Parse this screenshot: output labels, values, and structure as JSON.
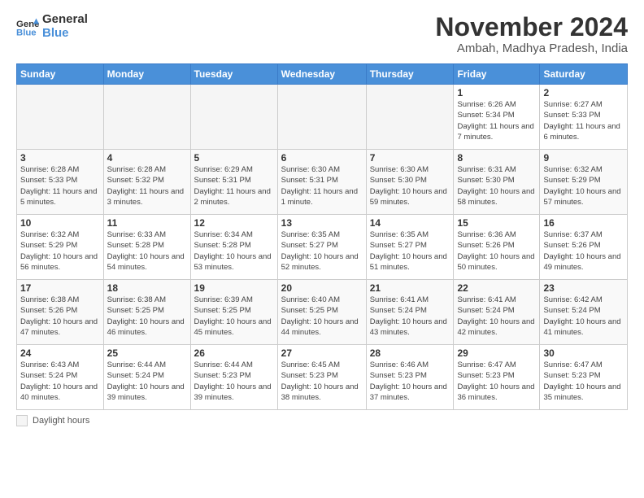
{
  "header": {
    "logo_line1": "General",
    "logo_line2": "Blue",
    "month": "November 2024",
    "location": "Ambah, Madhya Pradesh, India"
  },
  "weekdays": [
    "Sunday",
    "Monday",
    "Tuesday",
    "Wednesday",
    "Thursday",
    "Friday",
    "Saturday"
  ],
  "weeks": [
    [
      {
        "day": "",
        "info": ""
      },
      {
        "day": "",
        "info": ""
      },
      {
        "day": "",
        "info": ""
      },
      {
        "day": "",
        "info": ""
      },
      {
        "day": "",
        "info": ""
      },
      {
        "day": "1",
        "info": "Sunrise: 6:26 AM\nSunset: 5:34 PM\nDaylight: 11 hours and 7 minutes."
      },
      {
        "day": "2",
        "info": "Sunrise: 6:27 AM\nSunset: 5:33 PM\nDaylight: 11 hours and 6 minutes."
      }
    ],
    [
      {
        "day": "3",
        "info": "Sunrise: 6:28 AM\nSunset: 5:33 PM\nDaylight: 11 hours and 5 minutes."
      },
      {
        "day": "4",
        "info": "Sunrise: 6:28 AM\nSunset: 5:32 PM\nDaylight: 11 hours and 3 minutes."
      },
      {
        "day": "5",
        "info": "Sunrise: 6:29 AM\nSunset: 5:31 PM\nDaylight: 11 hours and 2 minutes."
      },
      {
        "day": "6",
        "info": "Sunrise: 6:30 AM\nSunset: 5:31 PM\nDaylight: 11 hours and 1 minute."
      },
      {
        "day": "7",
        "info": "Sunrise: 6:30 AM\nSunset: 5:30 PM\nDaylight: 10 hours and 59 minutes."
      },
      {
        "day": "8",
        "info": "Sunrise: 6:31 AM\nSunset: 5:30 PM\nDaylight: 10 hours and 58 minutes."
      },
      {
        "day": "9",
        "info": "Sunrise: 6:32 AM\nSunset: 5:29 PM\nDaylight: 10 hours and 57 minutes."
      }
    ],
    [
      {
        "day": "10",
        "info": "Sunrise: 6:32 AM\nSunset: 5:29 PM\nDaylight: 10 hours and 56 minutes."
      },
      {
        "day": "11",
        "info": "Sunrise: 6:33 AM\nSunset: 5:28 PM\nDaylight: 10 hours and 54 minutes."
      },
      {
        "day": "12",
        "info": "Sunrise: 6:34 AM\nSunset: 5:28 PM\nDaylight: 10 hours and 53 minutes."
      },
      {
        "day": "13",
        "info": "Sunrise: 6:35 AM\nSunset: 5:27 PM\nDaylight: 10 hours and 52 minutes."
      },
      {
        "day": "14",
        "info": "Sunrise: 6:35 AM\nSunset: 5:27 PM\nDaylight: 10 hours and 51 minutes."
      },
      {
        "day": "15",
        "info": "Sunrise: 6:36 AM\nSunset: 5:26 PM\nDaylight: 10 hours and 50 minutes."
      },
      {
        "day": "16",
        "info": "Sunrise: 6:37 AM\nSunset: 5:26 PM\nDaylight: 10 hours and 49 minutes."
      }
    ],
    [
      {
        "day": "17",
        "info": "Sunrise: 6:38 AM\nSunset: 5:26 PM\nDaylight: 10 hours and 47 minutes."
      },
      {
        "day": "18",
        "info": "Sunrise: 6:38 AM\nSunset: 5:25 PM\nDaylight: 10 hours and 46 minutes."
      },
      {
        "day": "19",
        "info": "Sunrise: 6:39 AM\nSunset: 5:25 PM\nDaylight: 10 hours and 45 minutes."
      },
      {
        "day": "20",
        "info": "Sunrise: 6:40 AM\nSunset: 5:25 PM\nDaylight: 10 hours and 44 minutes."
      },
      {
        "day": "21",
        "info": "Sunrise: 6:41 AM\nSunset: 5:24 PM\nDaylight: 10 hours and 43 minutes."
      },
      {
        "day": "22",
        "info": "Sunrise: 6:41 AM\nSunset: 5:24 PM\nDaylight: 10 hours and 42 minutes."
      },
      {
        "day": "23",
        "info": "Sunrise: 6:42 AM\nSunset: 5:24 PM\nDaylight: 10 hours and 41 minutes."
      }
    ],
    [
      {
        "day": "24",
        "info": "Sunrise: 6:43 AM\nSunset: 5:24 PM\nDaylight: 10 hours and 40 minutes."
      },
      {
        "day": "25",
        "info": "Sunrise: 6:44 AM\nSunset: 5:24 PM\nDaylight: 10 hours and 39 minutes."
      },
      {
        "day": "26",
        "info": "Sunrise: 6:44 AM\nSunset: 5:23 PM\nDaylight: 10 hours and 39 minutes."
      },
      {
        "day": "27",
        "info": "Sunrise: 6:45 AM\nSunset: 5:23 PM\nDaylight: 10 hours and 38 minutes."
      },
      {
        "day": "28",
        "info": "Sunrise: 6:46 AM\nSunset: 5:23 PM\nDaylight: 10 hours and 37 minutes."
      },
      {
        "day": "29",
        "info": "Sunrise: 6:47 AM\nSunset: 5:23 PM\nDaylight: 10 hours and 36 minutes."
      },
      {
        "day": "30",
        "info": "Sunrise: 6:47 AM\nSunset: 5:23 PM\nDaylight: 10 hours and 35 minutes."
      }
    ]
  ],
  "footer": {
    "legend_label": "Daylight hours"
  }
}
